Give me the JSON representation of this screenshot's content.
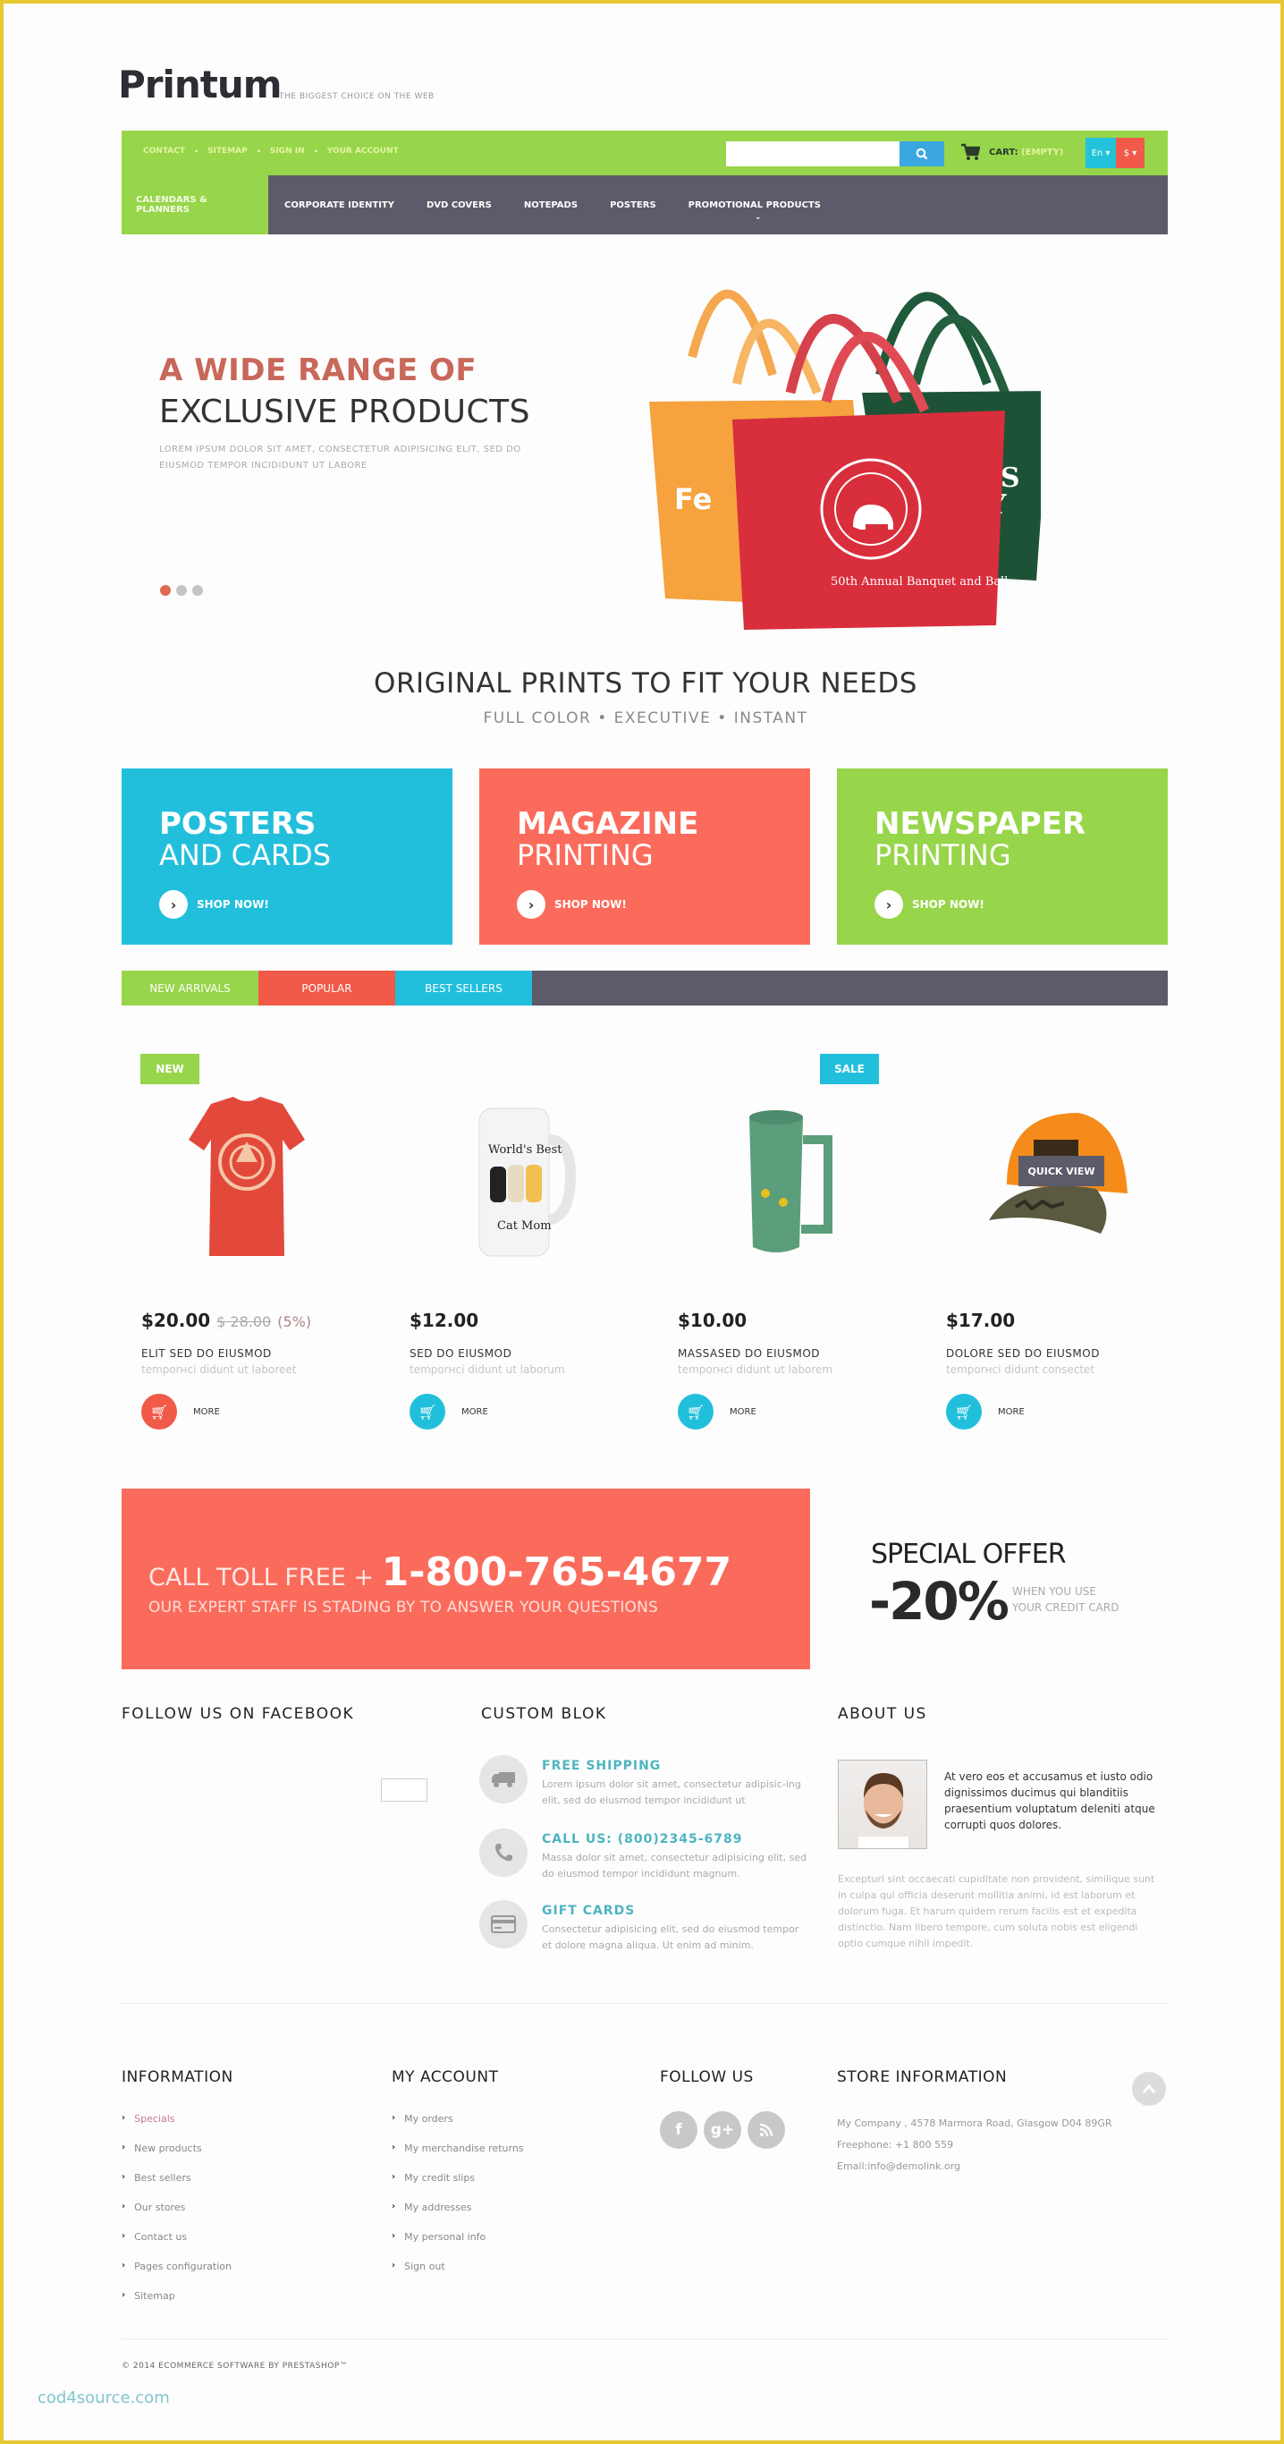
{
  "header": {
    "logo": "Printum",
    "tagline": "THE BIGGEST CHOICE ON THE WEB",
    "top_links": [
      "CONTACT",
      "SITEMAP",
      "SIGN IN",
      "YOUR ACCOUNT"
    ],
    "search": {
      "value": "",
      "placeholder": "",
      "button_icon": "search-icon"
    },
    "cart": {
      "label": "CART:",
      "status": "(EMPTY)"
    },
    "language": "En ▾",
    "currency": "$ ▾",
    "colors": {
      "topbar": "#97d54a",
      "nav": "#5c5b69",
      "search_btn": "#3aa7e0",
      "lang": "#22c3da",
      "currency": "#f15a48"
    }
  },
  "nav": {
    "items": [
      {
        "label": "CALENDARS & PLANNERS",
        "active": true
      },
      {
        "label": "CORPORATE IDENTITY"
      },
      {
        "label": "DVD COVERS"
      },
      {
        "label": "NOTEPADS"
      },
      {
        "label": "POSTERS"
      },
      {
        "label": "PROMOTIONAL PRODUCTS",
        "has_dropdown": true
      }
    ]
  },
  "hero": {
    "title_line1": "A WIDE RANGE OF",
    "title_line2": "EXCLUSIVE PRODUCTS",
    "text": "LOREM IPSUM DOLOR SIT AMET, CONSECTETUR ADIPISICING ELIT, SED DO EIUSMOD TEMPOR INCIDIDUNT UT LABORE",
    "slides": 3,
    "active_slide": 1,
    "image": "tote-bags"
  },
  "intro": {
    "headline": "ORIGINAL PRINTS TO FIT YOUR NEEDS",
    "subline": "FULL COLOR  •  EXECUTIVE  •  INSTANT"
  },
  "banners": [
    {
      "line1": "POSTERS",
      "line2": "AND CARDS",
      "cta": "SHOP NOW!",
      "color": "#22bfdc"
    },
    {
      "line1": "MAGAZINE",
      "line2": "PRINTING",
      "cta": "SHOP NOW!",
      "color": "#fb6b5c"
    },
    {
      "line1": "NEWSPAPER",
      "line2": "PRINTING",
      "cta": "SHOP NOW!",
      "color": "#97d54a"
    }
  ],
  "tabs": [
    {
      "label": "NEW ARRIVALS",
      "color": "#97d54a"
    },
    {
      "label": "POPULAR",
      "color": "#f15a48"
    },
    {
      "label": "BEST SELLERS",
      "color": "#22bfdc"
    }
  ],
  "products": [
    {
      "badge": "NEW",
      "image": "t-shirt",
      "price": "$20.00",
      "old_price": "$ 28.00",
      "discount": "(5%)",
      "name": "ELIT SED DO EIUSMOD",
      "desc": "temporнci didunt ut laboreet",
      "more": "MORE",
      "btn_color": "#f15a48"
    },
    {
      "badge": "",
      "image": "mug-white",
      "price": "$12.00",
      "name": "SED DO EIUSMOD",
      "desc": "temporнci didunt ut laborum",
      "more": "MORE",
      "btn_color": "#22bfdc"
    },
    {
      "badge": "SALE",
      "image": "mug-green",
      "price": "$10.00",
      "name": "MASSASED DO EIUSMOD",
      "desc": "temporнci didunt ut laborem",
      "more": "MORE",
      "btn_color": "#22bfdc"
    },
    {
      "badge": "",
      "image": "cap",
      "quick_view": "QUICK VIEW",
      "price": "$17.00",
      "name": "DOLORE SED DO EIUSMOD",
      "desc": "temporнci didunt consectet",
      "more": "MORE",
      "btn_color": "#22bfdc"
    }
  ],
  "call": {
    "prefix": "CALL TOLL FREE + ",
    "number": "1-800-765-4677",
    "text": "OUR EXPERT STAFF IS STADING BY TO ANSWER YOUR QUESTIONS"
  },
  "offer": {
    "title": "SPECIAL OFFER",
    "amount": "-20%",
    "note_line1": "WHEN YOU USE",
    "note_line2": "YOUR CREDIT CARD"
  },
  "facebook": {
    "title": "FOLLOW US ON FACEBOOK"
  },
  "custom_block": {
    "title": "CUSTOM BLOK",
    "items": [
      {
        "icon": "truck-icon",
        "title": "FREE SHIPPING",
        "text": "Lorem ipsum dolor sit amet, consectetur adipisic-ing elit, sed do eiusmod tempor incididunt ut"
      },
      {
        "icon": "phone-icon",
        "title": "CALL US: (800)2345-6789",
        "text": "Massa dolor sit amet, consectetur adipisicing elit, sed do eiusmod tempor incididunt magnum."
      },
      {
        "icon": "credit-card-icon",
        "title": "GIFT CARDS",
        "text": "Consectetur adipisicing elit, sed do eiusmod tempor et dolore magna aliqua. Ut enim ad minim."
      }
    ]
  },
  "about": {
    "title": "ABOUT US",
    "lead": "At vero eos et accusamus et iusto odio dignissimos ducimus qui blanditiis praesentium voluptatum deleniti atque corrupti quos dolores.",
    "text": "Excepturi sint occaecati cupiditate non provident, similique sunt in culpa qui officia deserunt mollitia animi, id est laborum et dolorum fuga. Et harum quidem rerum facilis est et expedita distinctio. Nam libero tempore, cum soluta nobis est eligendi optio cumque nihil impedit."
  },
  "footer": {
    "information": {
      "title": "INFORMATION",
      "links": [
        "Specials",
        "New products",
        "Best sellers",
        "Our stores",
        "Contact us",
        "Pages configuration",
        "Sitemap"
      ]
    },
    "account": {
      "title": "MY ACCOUNT",
      "links": [
        "My orders",
        "My merchandise returns",
        "My credit slips",
        "My addresses",
        "My personal info",
        "Sign out"
      ]
    },
    "follow": {
      "title": "FOLLOW US",
      "icons": [
        "f",
        "g+",
        "rss"
      ]
    },
    "store": {
      "title": "STORE INFORMATION",
      "address": "My Company , 4578 Marmora Road, Glasgow D04 89GR",
      "phone": "Freephone:  +1 800 559",
      "email": "Email:info@demolink.org"
    },
    "copyright": "© 2014 ECOMMERCE SOFTWARE BY PRESTASHOP™",
    "watermark": "cod4source.com"
  }
}
